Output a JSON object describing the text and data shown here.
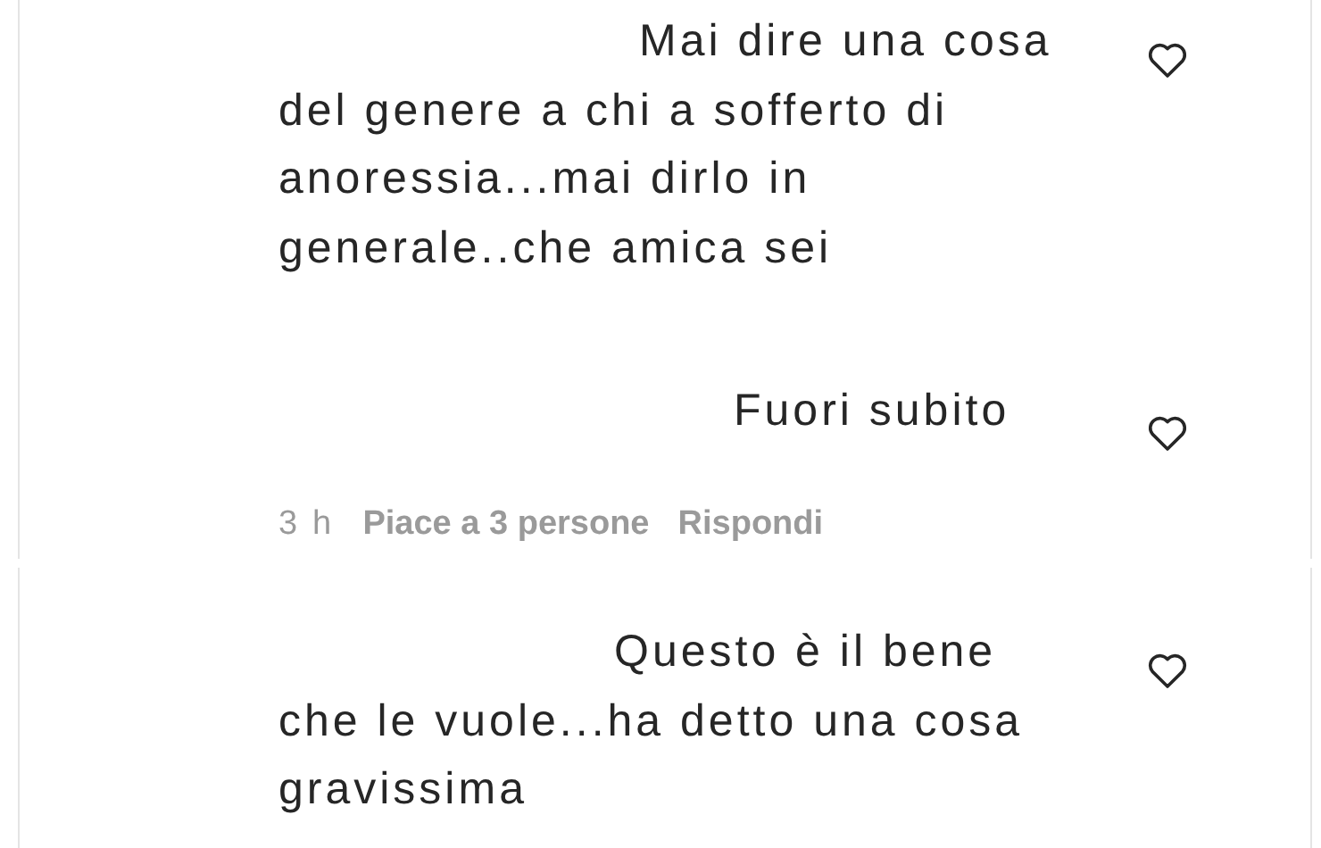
{
  "comments": [
    {
      "lines": [
        "Mai dire una cosa",
        "del genere a chi a sofferto di",
        "anoressia...mai dirlo in",
        "generale..che amica sei"
      ],
      "liked": false
    },
    {
      "lines": [
        "Fuori subito"
      ],
      "liked": false,
      "meta": {
        "time": "3 h",
        "likes": "Piace a 3 persone",
        "reply": "Rispondi"
      }
    },
    {
      "lines": [
        "Questo è il bene",
        "che le vuole...ha detto una cosa",
        "gravissima"
      ],
      "liked": false
    }
  ]
}
